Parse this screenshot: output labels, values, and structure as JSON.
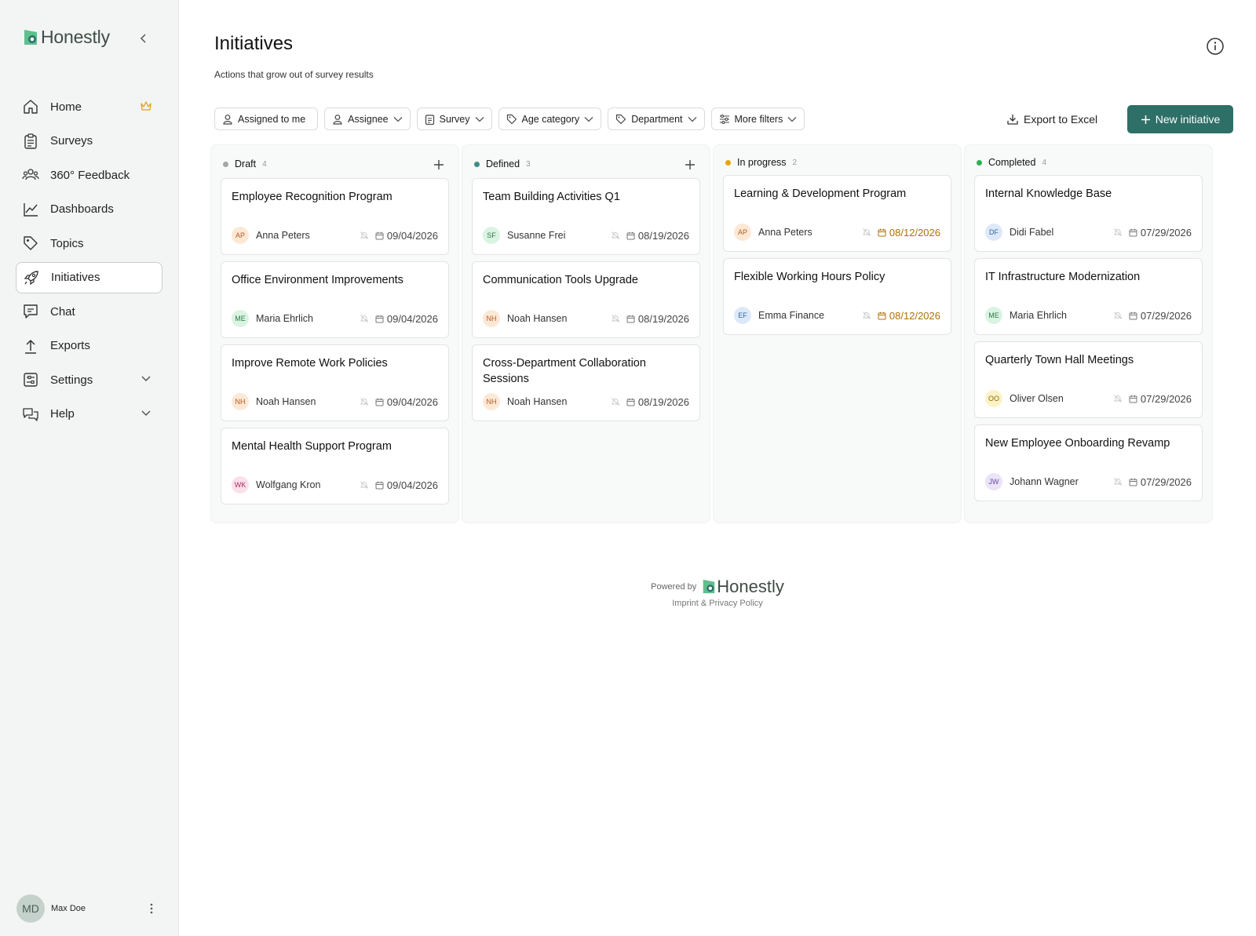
{
  "brand": {
    "name": "Honestly",
    "accent": "#2e6f67"
  },
  "sidebar": {
    "items": [
      {
        "label": "Home",
        "icon": "home-icon"
      },
      {
        "label": "Surveys",
        "icon": "clipboard-icon"
      },
      {
        "label": "360° Feedback",
        "icon": "people-icon"
      },
      {
        "label": "Dashboards",
        "icon": "chart-line-icon"
      },
      {
        "label": "Topics",
        "icon": "tag-icon"
      },
      {
        "label": "Initiatives",
        "icon": "rocket-icon",
        "active": true
      },
      {
        "label": "Chat",
        "icon": "chat-icon"
      },
      {
        "label": "Exports",
        "icon": "upload-icon"
      },
      {
        "label": "Settings",
        "icon": "settings-icon"
      },
      {
        "label": "Help",
        "icon": "help-icon"
      }
    ],
    "user": {
      "initials": "MD",
      "name": "Max Doe"
    }
  },
  "header": {
    "title": "Initiatives",
    "subtitle": "Actions that grow out of survey results"
  },
  "filters": [
    "Assigned to me",
    "Assignee",
    "Survey",
    "Age category",
    "Department",
    "More filters"
  ],
  "actions": {
    "export_label": "Export to Excel",
    "new_label": "New initiative"
  },
  "columns": [
    {
      "name": "Draft",
      "count": "4",
      "dot": "#a3a7a5",
      "cards": [
        {
          "title": "Employee Recognition Program",
          "initials": "AP",
          "person": "Anna Peters",
          "date": "09/04/2026",
          "avatar_bg": "#fde8d6",
          "avatar_fg": "#b25a1c"
        },
        {
          "title": "Office Environment Improvements",
          "initials": "ME",
          "person": "Maria Ehrlich",
          "date": "09/04/2026",
          "avatar_bg": "#dbf3e2",
          "avatar_fg": "#2c7a45"
        },
        {
          "title": "Improve Remote Work Policies",
          "initials": "NH",
          "person": "Noah Hansen",
          "date": "09/04/2026",
          "avatar_bg": "#fde8d6",
          "avatar_fg": "#b25a1c"
        },
        {
          "title": "Mental Health Support Program",
          "initials": "WK",
          "person": "Wolfgang Kron",
          "date": "09/04/2026",
          "avatar_bg": "#fbe0ea",
          "avatar_fg": "#a3305a"
        }
      ]
    },
    {
      "name": "Defined",
      "count": "3",
      "dot": "#3d8f86",
      "cards": [
        {
          "title": "Team Building Activities Q1",
          "initials": "SF",
          "person": "Susanne Frei",
          "date": "08/19/2026",
          "avatar_bg": "#dbf3e2",
          "avatar_fg": "#2c7a45"
        },
        {
          "title": "Communication Tools Upgrade",
          "initials": "NH",
          "person": "Noah Hansen",
          "date": "08/19/2026",
          "avatar_bg": "#fde8d6",
          "avatar_fg": "#b25a1c"
        },
        {
          "title": "Cross-Department Collaboration Sessions",
          "initials": "NH",
          "person": "Noah Hansen",
          "date": "08/19/2026",
          "avatar_bg": "#fde8d6",
          "avatar_fg": "#b25a1c"
        }
      ]
    },
    {
      "name": "In progress",
      "count": "2",
      "dot": "#e3a60f",
      "cards": [
        {
          "title": "Learning & Development Program",
          "initials": "AP",
          "person": "Anna Peters",
          "date": "08/12/2026",
          "due": true,
          "avatar_bg": "#fde8d6",
          "avatar_fg": "#b25a1c"
        },
        {
          "title": "Flexible Working Hours Policy",
          "initials": "EF",
          "person": "Emma Finance",
          "date": "08/12/2026",
          "due": true,
          "avatar_bg": "#dde9f8",
          "avatar_fg": "#3566a8"
        }
      ]
    },
    {
      "name": "Completed",
      "count": "4",
      "dot": "#2bb24f",
      "cards": [
        {
          "title": "Internal Knowledge Base",
          "initials": "DF",
          "person": "Didi Fabel",
          "date": "07/29/2026",
          "avatar_bg": "#dde9f8",
          "avatar_fg": "#3566a8"
        },
        {
          "title": "IT Infrastructure Modernization",
          "initials": "ME",
          "person": "Maria Ehrlich",
          "date": "07/29/2026",
          "avatar_bg": "#dbf3e2",
          "avatar_fg": "#2c7a45"
        },
        {
          "title": "Quarterly Town Hall Meetings",
          "initials": "OO",
          "person": "Oliver Olsen",
          "date": "07/29/2026",
          "avatar_bg": "#fbf3c8",
          "avatar_fg": "#8a6a05"
        },
        {
          "title": "New Employee Onboarding Revamp",
          "initials": "JW",
          "person": "Johann Wagner",
          "date": "07/29/2026",
          "avatar_bg": "#ebe3f8",
          "avatar_fg": "#6a46a8"
        }
      ]
    }
  ],
  "footer": {
    "powered": "Powered by",
    "brand": "Honestly",
    "links": "Imprint & Privacy Policy"
  }
}
